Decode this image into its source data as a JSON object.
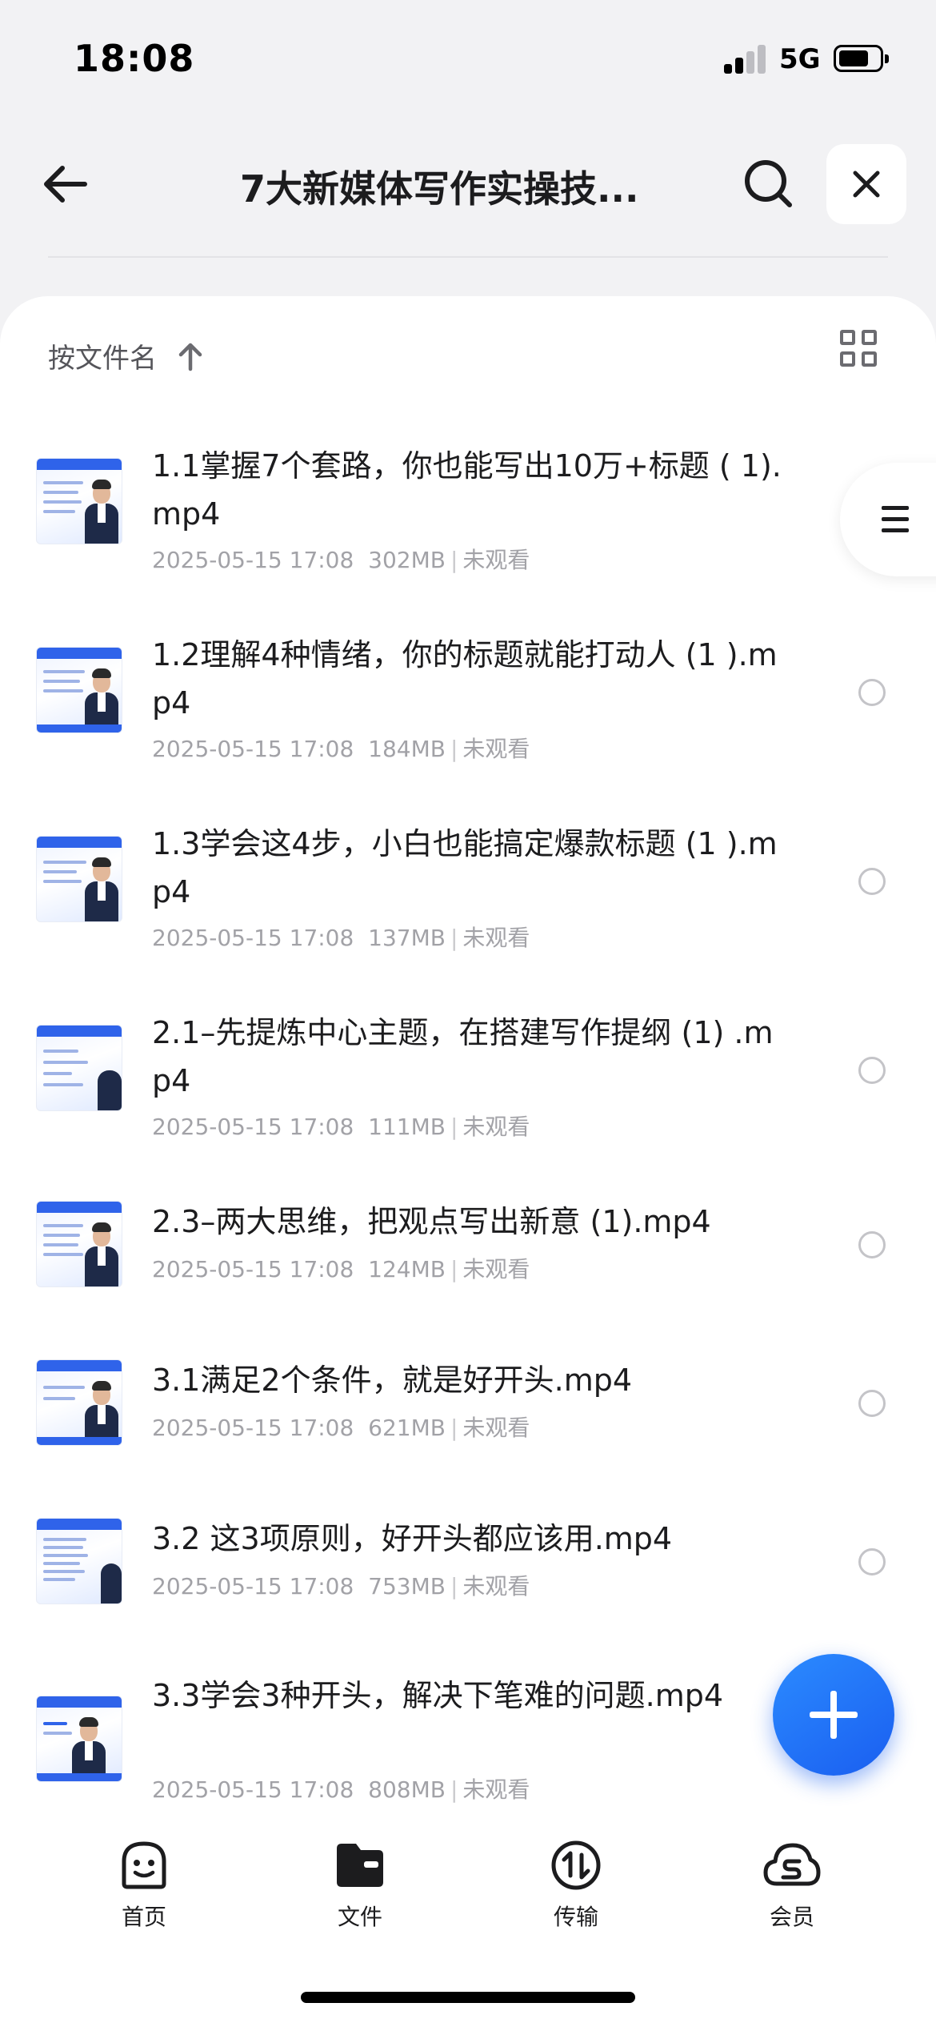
{
  "status_bar": {
    "time": "18:08",
    "network": "5G"
  },
  "nav": {
    "title": "7大新媒体写作实操技..."
  },
  "toolbar": {
    "sort_label": "按文件名"
  },
  "files": [
    {
      "name": "1.1掌握7个套路，你也能写出10万+标题 ( 1).mp4",
      "date": "2025-05-15 17:08",
      "size": "302MB",
      "status": "未观看"
    },
    {
      "name": "1.2理解4种情绪，你的标题就能打动人 (1 ).mp4",
      "date": "2025-05-15 17:08",
      "size": "184MB",
      "status": "未观看"
    },
    {
      "name": "1.3学会这4步，小白也能搞定爆款标题 (1 ).mp4",
      "date": "2025-05-15 17:08",
      "size": "137MB",
      "status": "未观看"
    },
    {
      "name": "2.1–先提炼中心主题，在搭建写作提纲 (1) .mp4",
      "date": "2025-05-15 17:08",
      "size": "111MB",
      "status": "未观看"
    },
    {
      "name": "2.3–两大思维，把观点写出新意 (1).mp4",
      "date": "2025-05-15 17:08",
      "size": "124MB",
      "status": "未观看"
    },
    {
      "name": "3.1满足2个条件，就是好开头.mp4",
      "date": "2025-05-15 17:08",
      "size": "621MB",
      "status": "未观看"
    },
    {
      "name": "3.2 这3项原则，好开头都应该用.mp4",
      "date": "2025-05-15 17:08",
      "size": "753MB",
      "status": "未观看"
    },
    {
      "name": "3.3学会3种开头，解决下笔难的问题.mp4",
      "date": "2025-05-15 17:08",
      "size": "808MB",
      "status": "未观看"
    }
  ],
  "tabs": [
    {
      "label": "首页",
      "icon": "smiley-face-icon"
    },
    {
      "label": "文件",
      "icon": "folder-icon"
    },
    {
      "label": "传输",
      "icon": "transfer-icon"
    },
    {
      "label": "会员",
      "icon": "cloud-icon"
    }
  ],
  "colors": {
    "accent": "#1a5ef0",
    "text_secondary": "#a2a2a7"
  }
}
